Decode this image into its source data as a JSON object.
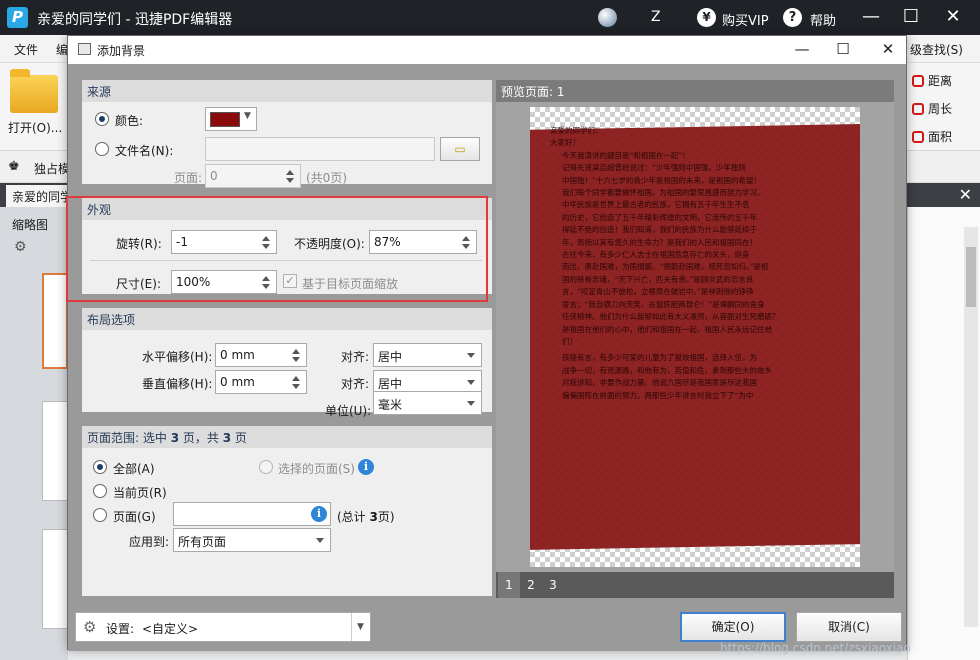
{
  "app": {
    "title": "亲爱的同学们 - 迅捷PDF编辑器",
    "logo": "P",
    "user": "Z",
    "vip_label": "购买VIP",
    "vip_symbol": "¥",
    "help_label": "帮助",
    "help_symbol": "?"
  },
  "window_controls": {
    "minimize": "—",
    "maximize": "☐",
    "close": "✕"
  },
  "menu": {
    "file": "文件",
    "edit": "编",
    "find": "级查找(S)"
  },
  "toolbar": {
    "open": "打开(O)...",
    "distance": "距离",
    "perimeter": "周长",
    "area": "面积"
  },
  "strip": {
    "label": "独占模"
  },
  "doc_tab": {
    "label": "亲爱的同学",
    "close": "✕"
  },
  "thumbs": {
    "label": "缩略图"
  },
  "dialog": {
    "title": "添加背景",
    "source": {
      "header": "来源",
      "color_label": "颜色:",
      "color_value": "#8a0b0b",
      "file_label": "文件名(N):",
      "page_label": "页面:",
      "page_value": "0",
      "page_total": "(共0页)"
    },
    "appearance": {
      "header": "外观",
      "rotation_label": "旋转(R):",
      "rotation_value": "-1",
      "opacity_label": "不透明度(O):",
      "opacity_value": "87%",
      "size_label": "尺寸(E):",
      "size_value": "100%",
      "scale_label": "基于目标页面缩放"
    },
    "layout": {
      "header": "布局选项",
      "h_offset_label": "水平偏移(H):",
      "h_offset_value": "0 mm",
      "v_offset_label": "垂直偏移(H):",
      "v_offset_value": "0 mm",
      "align_label": "对齐:",
      "align_h_value": "居中",
      "align_v_value": "居中",
      "unit_label": "单位(U):",
      "unit_value": "毫米"
    },
    "range": {
      "header_prefix": "页面范围: 选中",
      "selected": "3",
      "header_mid": "页，共",
      "total": "3",
      "header_suffix": "页",
      "all": "全部(A)",
      "selected_pages": "选择的页面(S)",
      "current": "当前页(R)",
      "pages": "页面(G)",
      "pages_total_prefix": "(总计",
      "pages_total": "3",
      "pages_total_suffix": "页)",
      "apply_label": "应用到:",
      "apply_value": "所有页面"
    },
    "preview": {
      "header": "预览页面: 1",
      "pages": [
        "1",
        "2",
        "3"
      ],
      "text": [
        "亲爱的同学们：",
        "大家好！",
        "今天我演讲的题目是“和祖国在一起”！",
        "记得先贤梁启超曾经说过：“少年强则中国强，少年独则",
        "中国独！”十六七岁的青少年是祖国的未来，是祖国的希望！",
        "我们每个同学都要做怀祖国，为祖国的繁荣昌盛而努力学习。",
        "中华民族是世界上最古老的民族，它拥有五千年生生不息",
        "的历史，它创造了五千年精彩辉煌的文明，它流传的五千年",
        "得延不绝的创造！我们知道，我们的民族为什么能够延续于",
        "年，昂扬以其有悠久的生命力？是我们的人民和祖国同在！",
        "古往今来，有多少仁人志士在祖国危急存亡的关头，挺身",
        "而出，勇赴国难，为国捐躯。“捐躯赴国难，视死忽如归。”是祖",
        "国的铁骨忠魂，“天下兴亡，匹夫有责。”是顾炎武的忠言良",
        "言，“咬定青山不放松，立根原在破岩中。”是林则徐的铮铮",
        "誓言；“我自横刀向天笑，去留肝胆两昆仑！”是谭嗣同的舍身",
        "任侠精神。他们为什么能够如此有大义凛然，从容面对生死磨砺？",
        "是祖国在他们的心中，他们和祖国在一起，祖国人民永远记住他",
        "们！",
        "孩提有言，有多少可爱的儿童为了报效祖国，选择入伍，为",
        "战争一切，有资源路，和他有为，若值和危，素到那些大的故乡",
        "对我讲知，非要作战力量。他说六国尽是我国家是尽这我国",
        "偏偏国阵在前面的努力，两那些少年讲言时我立下了“为中"
      ]
    },
    "settings": {
      "label": "设置:",
      "value": "<自定义>"
    },
    "ok": "确定(O)",
    "cancel": "取消(C)"
  },
  "watermark": "https://blog.csdn.net/zsxiaoxiao"
}
